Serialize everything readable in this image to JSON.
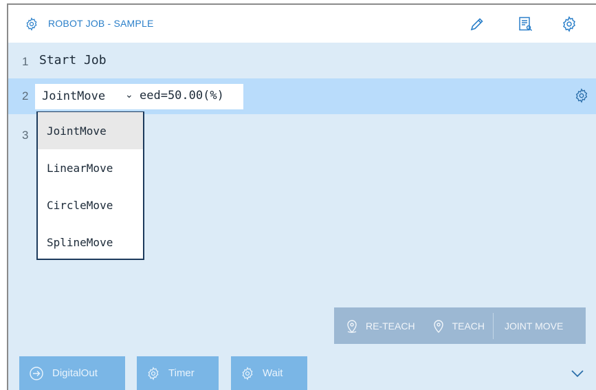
{
  "header": {
    "title": "ROBOT JOB - SAMPLE",
    "icons": [
      "gear-icon",
      "pencil-icon",
      "list-search-icon",
      "settings-icon"
    ]
  },
  "lines": [
    {
      "number": "1",
      "code": "Start Job"
    },
    {
      "number": "2",
      "command": "JointMove",
      "params": "eed=50.00(%)"
    },
    {
      "number": "3"
    }
  ],
  "dropdown": {
    "selected": "JointMove",
    "options": [
      "JointMove",
      "LinearMove",
      "CircleMove",
      "SplineMove"
    ]
  },
  "teach_bar": {
    "reteach_label": "RE-TEACH",
    "teach_label": "TEACH",
    "jointmove_label": "JOINT MOVE"
  },
  "bottom": {
    "digitalout_label": "DigitalOut",
    "timer_label": "Timer",
    "wait_label": "Wait"
  },
  "colors": {
    "accent": "#2a7fc9",
    "selected_row": "#b9dcfb",
    "background": "#dcebf7",
    "button": "#7ab6e6",
    "teach_bar": "#9cb8d3"
  }
}
